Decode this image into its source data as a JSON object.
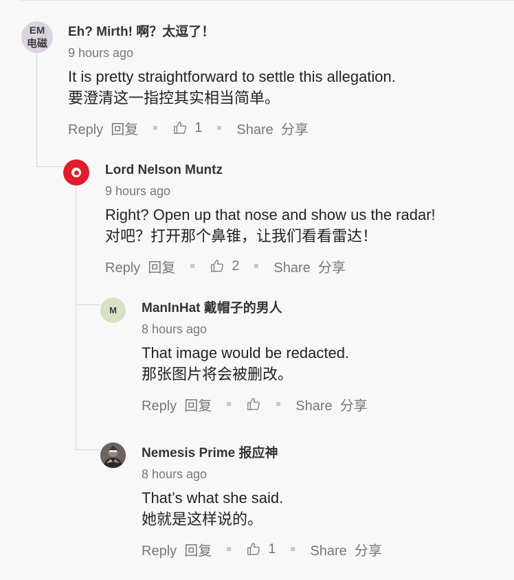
{
  "comments": [
    {
      "avatar_text": [
        "EM",
        "电磁"
      ],
      "author": "Eh? Mirth!  啊？太逗了！",
      "time": "9 hours ago",
      "body_lines": [
        "It is pretty straightforward to settle this allegation.",
        "要澄清这一指控其实相当简单。"
      ],
      "reply_label": "Reply  回复",
      "likes": "1",
      "share_label": "Share  分享"
    },
    {
      "avatar_icon": "target-logo-icon",
      "author": "Lord Nelson Muntz",
      "time": "9 hours ago",
      "body_lines": [
        "Right? Open up that nose and show us the radar!",
        "对吧？打开那个鼻锥，让我们看看雷达！"
      ],
      "reply_label": "Reply  回复",
      "likes": "2",
      "share_label": "Share  分享"
    },
    {
      "avatar_text": [
        "M"
      ],
      "author": "ManInHat  戴帽子的男人",
      "time": "8 hours ago",
      "body_lines": [
        "That image would be redacted.",
        "那张图片将会被删改。"
      ],
      "reply_label": "Reply  回复",
      "likes": "",
      "share_label": "Share  分享"
    },
    {
      "avatar_icon": "photo-avatar",
      "author": "Nemesis Prime  报应神",
      "time": "8 hours ago",
      "body_lines": [
        "That’s what she said.",
        "她就是这样说的。"
      ],
      "reply_label": "Reply  回复",
      "likes": "1",
      "share_label": "Share  分享"
    }
  ],
  "colors": {
    "accent_red": "#e21c2a",
    "meta_gray": "#777777"
  }
}
